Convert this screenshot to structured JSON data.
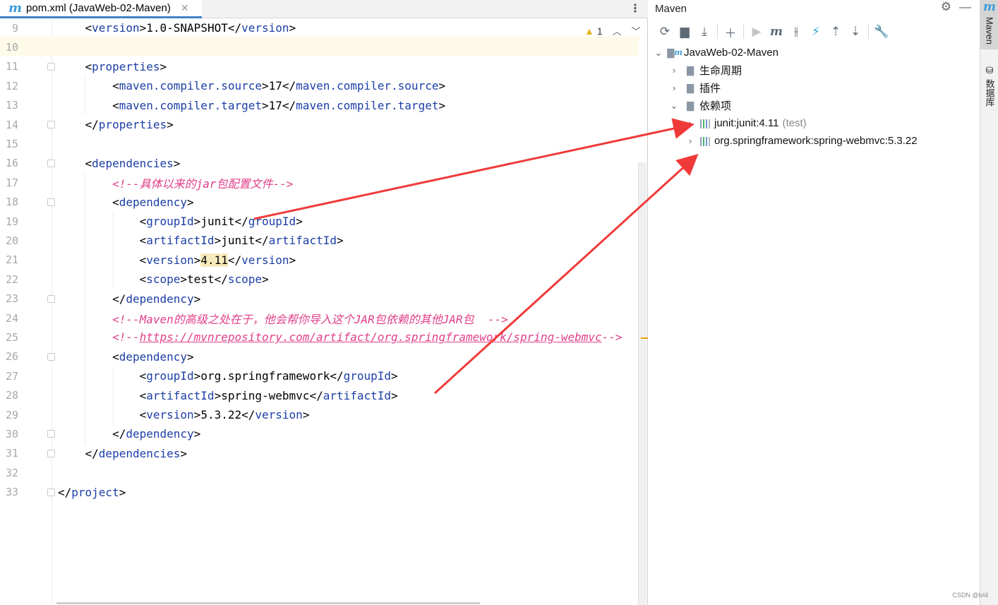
{
  "editor": {
    "tab": {
      "icon": "m",
      "label": "pom.xml (JavaWeb-02-Maven)",
      "close": "✕"
    },
    "inspection": {
      "warning_count": "1"
    },
    "lines": [
      {
        "n": "9",
        "parts": [
          [
            "br",
            "    <"
          ],
          [
            "tag",
            "version"
          ],
          [
            "br",
            ">"
          ],
          [
            "val",
            "1.0-SNAPSHOT"
          ],
          [
            "br",
            "</"
          ],
          [
            "tag",
            "version"
          ],
          [
            "br",
            ">"
          ]
        ]
      },
      {
        "n": "10",
        "parts": []
      },
      {
        "n": "11",
        "parts": [
          [
            "br",
            "    <"
          ],
          [
            "tag",
            "properties"
          ],
          [
            "br",
            ">"
          ]
        ]
      },
      {
        "n": "12",
        "parts": [
          [
            "br",
            "        <"
          ],
          [
            "tag",
            "maven.compiler.source"
          ],
          [
            "br",
            ">"
          ],
          [
            "val",
            "17"
          ],
          [
            "br",
            "</"
          ],
          [
            "tag",
            "maven.compiler.source"
          ],
          [
            "br",
            ">"
          ]
        ]
      },
      {
        "n": "13",
        "parts": [
          [
            "br",
            "        <"
          ],
          [
            "tag",
            "maven.compiler.target"
          ],
          [
            "br",
            ">"
          ],
          [
            "val",
            "17"
          ],
          [
            "br",
            "</"
          ],
          [
            "tag",
            "maven.compiler.target"
          ],
          [
            "br",
            ">"
          ]
        ]
      },
      {
        "n": "14",
        "parts": [
          [
            "br",
            "    </"
          ],
          [
            "tag",
            "properties"
          ],
          [
            "br",
            ">"
          ]
        ]
      },
      {
        "n": "15",
        "parts": []
      },
      {
        "n": "16",
        "parts": [
          [
            "br",
            "    <"
          ],
          [
            "tag",
            "dependencies"
          ],
          [
            "br",
            ">"
          ]
        ]
      },
      {
        "n": "17",
        "parts": [
          [
            "br",
            "        "
          ],
          [
            "cm",
            "<!--具体以来的jar包配置文件-->"
          ]
        ]
      },
      {
        "n": "18",
        "parts": [
          [
            "br",
            "        <"
          ],
          [
            "tag",
            "dependency"
          ],
          [
            "br",
            ">"
          ]
        ]
      },
      {
        "n": "19",
        "parts": [
          [
            "br",
            "            <"
          ],
          [
            "tag",
            "groupId"
          ],
          [
            "br",
            ">"
          ],
          [
            "val",
            "junit"
          ],
          [
            "br",
            "</"
          ],
          [
            "tag",
            "groupId"
          ],
          [
            "br",
            ">"
          ]
        ]
      },
      {
        "n": "20",
        "parts": [
          [
            "br",
            "            <"
          ],
          [
            "tag",
            "artifactId"
          ],
          [
            "br",
            ">"
          ],
          [
            "val",
            "junit"
          ],
          [
            "br",
            "</"
          ],
          [
            "tag",
            "artifactId"
          ],
          [
            "br",
            ">"
          ]
        ]
      },
      {
        "n": "21",
        "parts": [
          [
            "br",
            "            <"
          ],
          [
            "tag",
            "version"
          ],
          [
            "br",
            ">"
          ],
          [
            "hlval",
            "4.11"
          ],
          [
            "br",
            "</"
          ],
          [
            "tag",
            "version"
          ],
          [
            "br",
            ">"
          ]
        ]
      },
      {
        "n": "22",
        "parts": [
          [
            "br",
            "            <"
          ],
          [
            "tag",
            "scope"
          ],
          [
            "br",
            ">"
          ],
          [
            "val",
            "test"
          ],
          [
            "br",
            "</"
          ],
          [
            "tag",
            "scope"
          ],
          [
            "br",
            ">"
          ]
        ]
      },
      {
        "n": "23",
        "parts": [
          [
            "br",
            "        </"
          ],
          [
            "tag",
            "dependency"
          ],
          [
            "br",
            ">"
          ]
        ]
      },
      {
        "n": "24",
        "parts": [
          [
            "br",
            "        "
          ],
          [
            "cm",
            "<!--Maven的高级之处在于，他会帮你导入这个JAR包依赖的其他JAR包  -->"
          ]
        ]
      },
      {
        "n": "25",
        "parts": [
          [
            "br",
            "        "
          ],
          [
            "cm",
            "<!--"
          ],
          [
            "link",
            "https://mvnrepository.com/artifact/org.springframework/spring-webmvc"
          ],
          [
            "cm",
            "-->"
          ]
        ]
      },
      {
        "n": "26",
        "parts": [
          [
            "br",
            "        <"
          ],
          [
            "tag",
            "dependency"
          ],
          [
            "br",
            ">"
          ]
        ]
      },
      {
        "n": "27",
        "parts": [
          [
            "br",
            "            <"
          ],
          [
            "tag",
            "groupId"
          ],
          [
            "br",
            ">"
          ],
          [
            "val",
            "org.springframework"
          ],
          [
            "br",
            "</"
          ],
          [
            "tag",
            "groupId"
          ],
          [
            "br",
            ">"
          ]
        ]
      },
      {
        "n": "28",
        "parts": [
          [
            "br",
            "            <"
          ],
          [
            "tag",
            "artifactId"
          ],
          [
            "br",
            ">"
          ],
          [
            "val",
            "spring-webmvc"
          ],
          [
            "br",
            "</"
          ],
          [
            "tag",
            "artifactId"
          ],
          [
            "br",
            ">"
          ]
        ]
      },
      {
        "n": "29",
        "parts": [
          [
            "br",
            "            <"
          ],
          [
            "tag",
            "version"
          ],
          [
            "br",
            ">"
          ],
          [
            "val",
            "5.3.22"
          ],
          [
            "br",
            "</"
          ],
          [
            "tag",
            "version"
          ],
          [
            "br",
            ">"
          ]
        ]
      },
      {
        "n": "30",
        "parts": [
          [
            "br",
            "        </"
          ],
          [
            "tag",
            "dependency"
          ],
          [
            "br",
            ">"
          ]
        ]
      },
      {
        "n": "31",
        "parts": [
          [
            "br",
            "    </"
          ],
          [
            "tag",
            "dependencies"
          ],
          [
            "br",
            ">"
          ]
        ]
      },
      {
        "n": "32",
        "parts": []
      },
      {
        "n": "33",
        "parts": [
          [
            "br",
            "</"
          ],
          [
            "tag",
            "project"
          ],
          [
            "br",
            ">"
          ]
        ]
      }
    ]
  },
  "maven": {
    "title": "Maven",
    "toolbar": [
      "reload-icon",
      "add-folder-icon",
      "download-icon",
      "plus-icon",
      "run-icon",
      "maven-goal-icon",
      "skip-tests-icon",
      "offline-icon",
      "expand-all-icon",
      "collapse-all-icon",
      "settings-wrench-icon"
    ],
    "tree": {
      "root": "JavaWeb-02-Maven",
      "lifecycle": "生命周期",
      "plugins": "插件",
      "dependencies": "依赖项",
      "dep1": {
        "name": "junit:junit:4.11",
        "scope": "(test)"
      },
      "dep2": {
        "name": "org.springframework:spring-webmvc:5.3.22"
      }
    }
  },
  "stripe": {
    "maven_label": "Maven",
    "database_label": "数据库"
  },
  "watermark": "CSDN @lvl4",
  "colors": {
    "tag": "#1c3ea6",
    "comment": "#e0408a",
    "arrow": "#f03a3a",
    "accent": "#3d9ad8"
  }
}
